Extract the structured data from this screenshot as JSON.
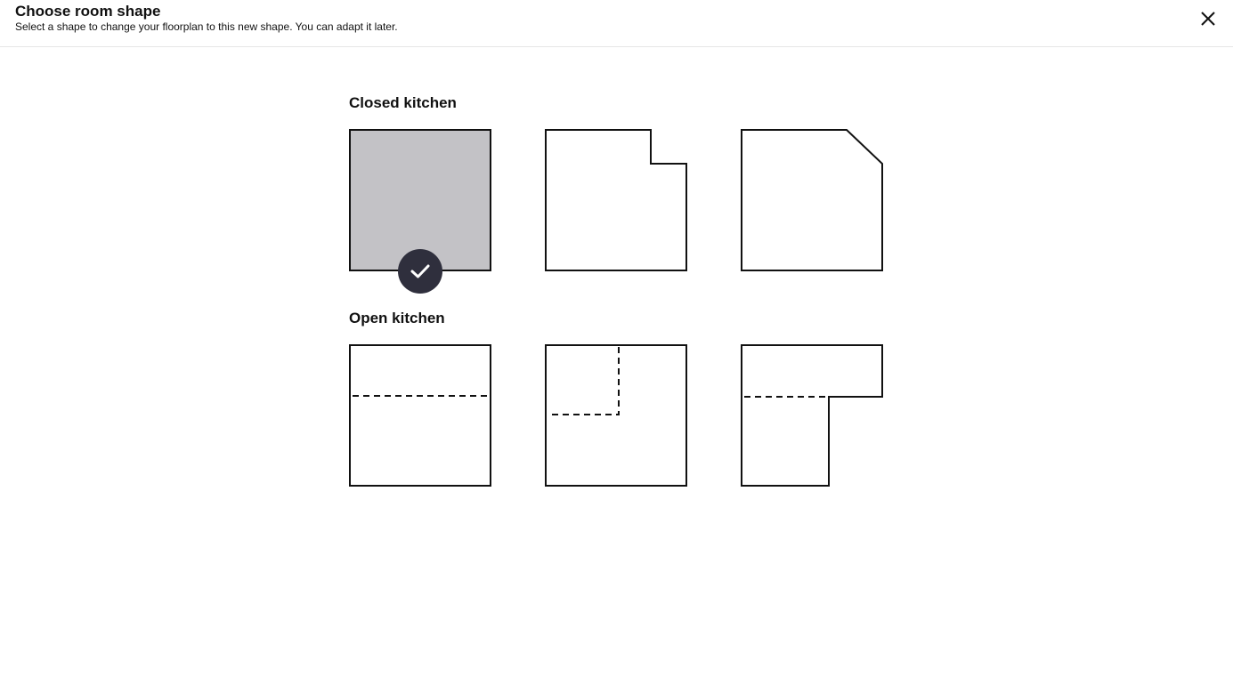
{
  "dialog": {
    "title": "Choose room shape",
    "subtitle": "Select a shape to change your floorplan to this new shape. You can adapt it later.",
    "close_icon": "close-icon"
  },
  "sections": [
    {
      "title": "Closed kitchen",
      "options": [
        {
          "shape": "square",
          "selected": true
        },
        {
          "shape": "square-with-notch-top-right",
          "selected": false
        },
        {
          "shape": "square-with-chamfer-top-right",
          "selected": false
        }
      ]
    },
    {
      "title": "Open kitchen",
      "options": [
        {
          "shape": "square-with-horizontal-open-divider",
          "selected": false
        },
        {
          "shape": "square-with-corner-open-divider",
          "selected": false
        },
        {
          "shape": "l-shape-with-open-divider",
          "selected": false
        }
      ]
    }
  ],
  "colors": {
    "selected_fill": "#c3c2c6",
    "outline": "#111111",
    "check_badge": "#2f2f3d",
    "check_mark": "#ffffff"
  },
  "icons": {
    "selected": "checkmark-icon"
  }
}
